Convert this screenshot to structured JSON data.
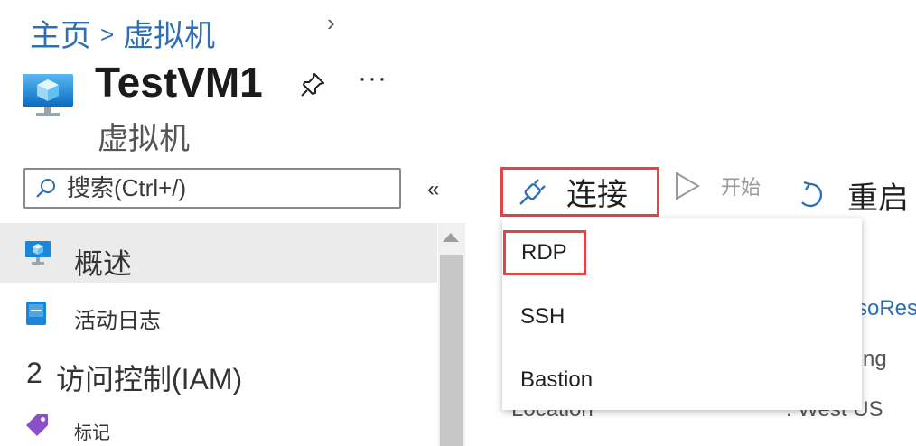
{
  "breadcrumb": {
    "home": "主页",
    "separator": ">",
    "current": "虚拟机",
    "chevron": "›"
  },
  "header": {
    "title": "TestVM1",
    "subtitle": "虚拟机",
    "more": "···",
    "vm_icon": "vm-monitor-icon",
    "pin_icon": "pin-icon"
  },
  "search": {
    "placeholder": "搜索(Ctrl+/)",
    "collapse": "«"
  },
  "sidebar": {
    "items": [
      {
        "label": "概述",
        "icon": "monitor-icon",
        "selected": true
      },
      {
        "label": "活动日志",
        "icon": "log-icon"
      },
      {
        "label": "访问控制(IAM)",
        "prefix": "2",
        "icon": "people-icon"
      },
      {
        "label": "标记",
        "icon": "tag-icon"
      }
    ]
  },
  "toolbar": {
    "connect": "连接",
    "start": "开始",
    "restart": "重启"
  },
  "dropdown": {
    "items": [
      "RDP",
      "SSH",
      "Bastion"
    ]
  },
  "background": {
    "resource_group_partial": "soRes",
    "status_partial": "ng",
    "location_label": "Location",
    "location_value": ": West US"
  },
  "colors": {
    "link": "#2f6fb5",
    "highlight_border": "#e0454a",
    "selected_bg": "#ebebeb"
  }
}
